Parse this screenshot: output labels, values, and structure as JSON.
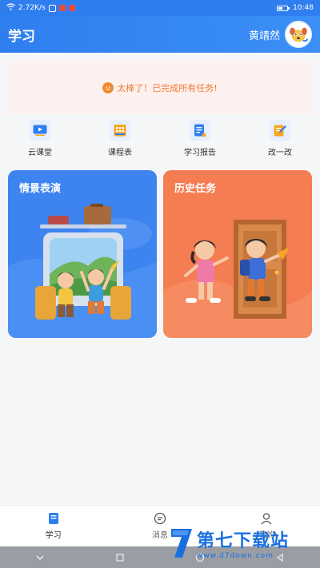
{
  "status_bar": {
    "network_speed": "2.72K/s",
    "time": "10:48"
  },
  "header": {
    "title": "学习",
    "username": "黄靖然"
  },
  "banner": {
    "message": "太棒了！已完成所有任务!"
  },
  "quick_nav": [
    {
      "label": "云课堂",
      "icon": "play-video-icon"
    },
    {
      "label": "课程表",
      "icon": "calendar-grid-icon"
    },
    {
      "label": "学习报告",
      "icon": "report-icon"
    },
    {
      "label": "改一改",
      "icon": "edit-pencil-icon"
    }
  ],
  "cards": [
    {
      "title": "情景表演"
    },
    {
      "title": "历史任务"
    }
  ],
  "tabs": [
    {
      "label": "学习",
      "active": true
    },
    {
      "label": "消息",
      "active": false
    },
    {
      "label": "我的",
      "active": false
    }
  ],
  "watermark": {
    "name": "第七下载站",
    "url": "www.d7down.com"
  },
  "colors": {
    "primary": "#2f7ef0",
    "card_blue": "#3d84f0",
    "card_orange": "#f57d52",
    "banner_bg": "#fdf1f0",
    "banner_text": "#f07a2e"
  }
}
